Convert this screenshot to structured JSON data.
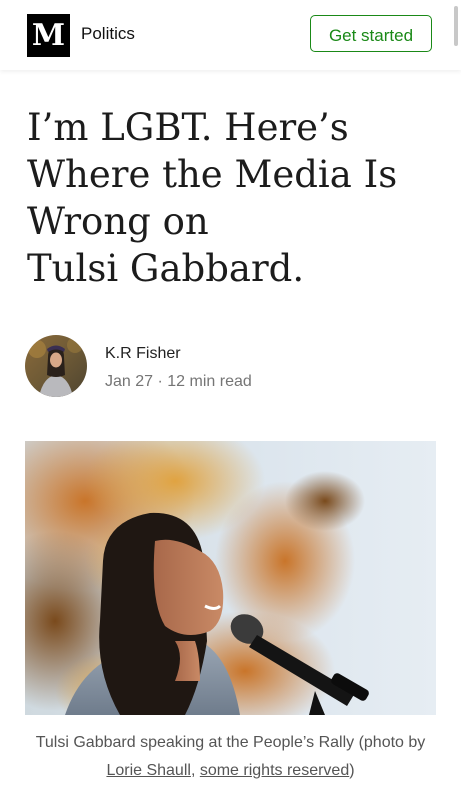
{
  "header": {
    "logo_letter": "M",
    "publication": "Politics",
    "cta_label": "Get started"
  },
  "article": {
    "title_lines": [
      "I’m LGBT. Here’s",
      "Where the Media Is",
      "Wrong on",
      "Tulsi Gabbard."
    ],
    "author": "K.R Fisher",
    "date": "Jan 27",
    "separator": "·",
    "read_time": "12 min read"
  },
  "caption": {
    "prefix": "Tulsi Gabbard speaking at the People’s Rally (photo by ",
    "link1": "Lorie Shaull",
    "middle": ", ",
    "link2": "some rights reserved",
    "suffix": ")"
  },
  "colors": {
    "accent": "#1a8917",
    "text": "#1c1c1c",
    "muted": "#757575"
  }
}
